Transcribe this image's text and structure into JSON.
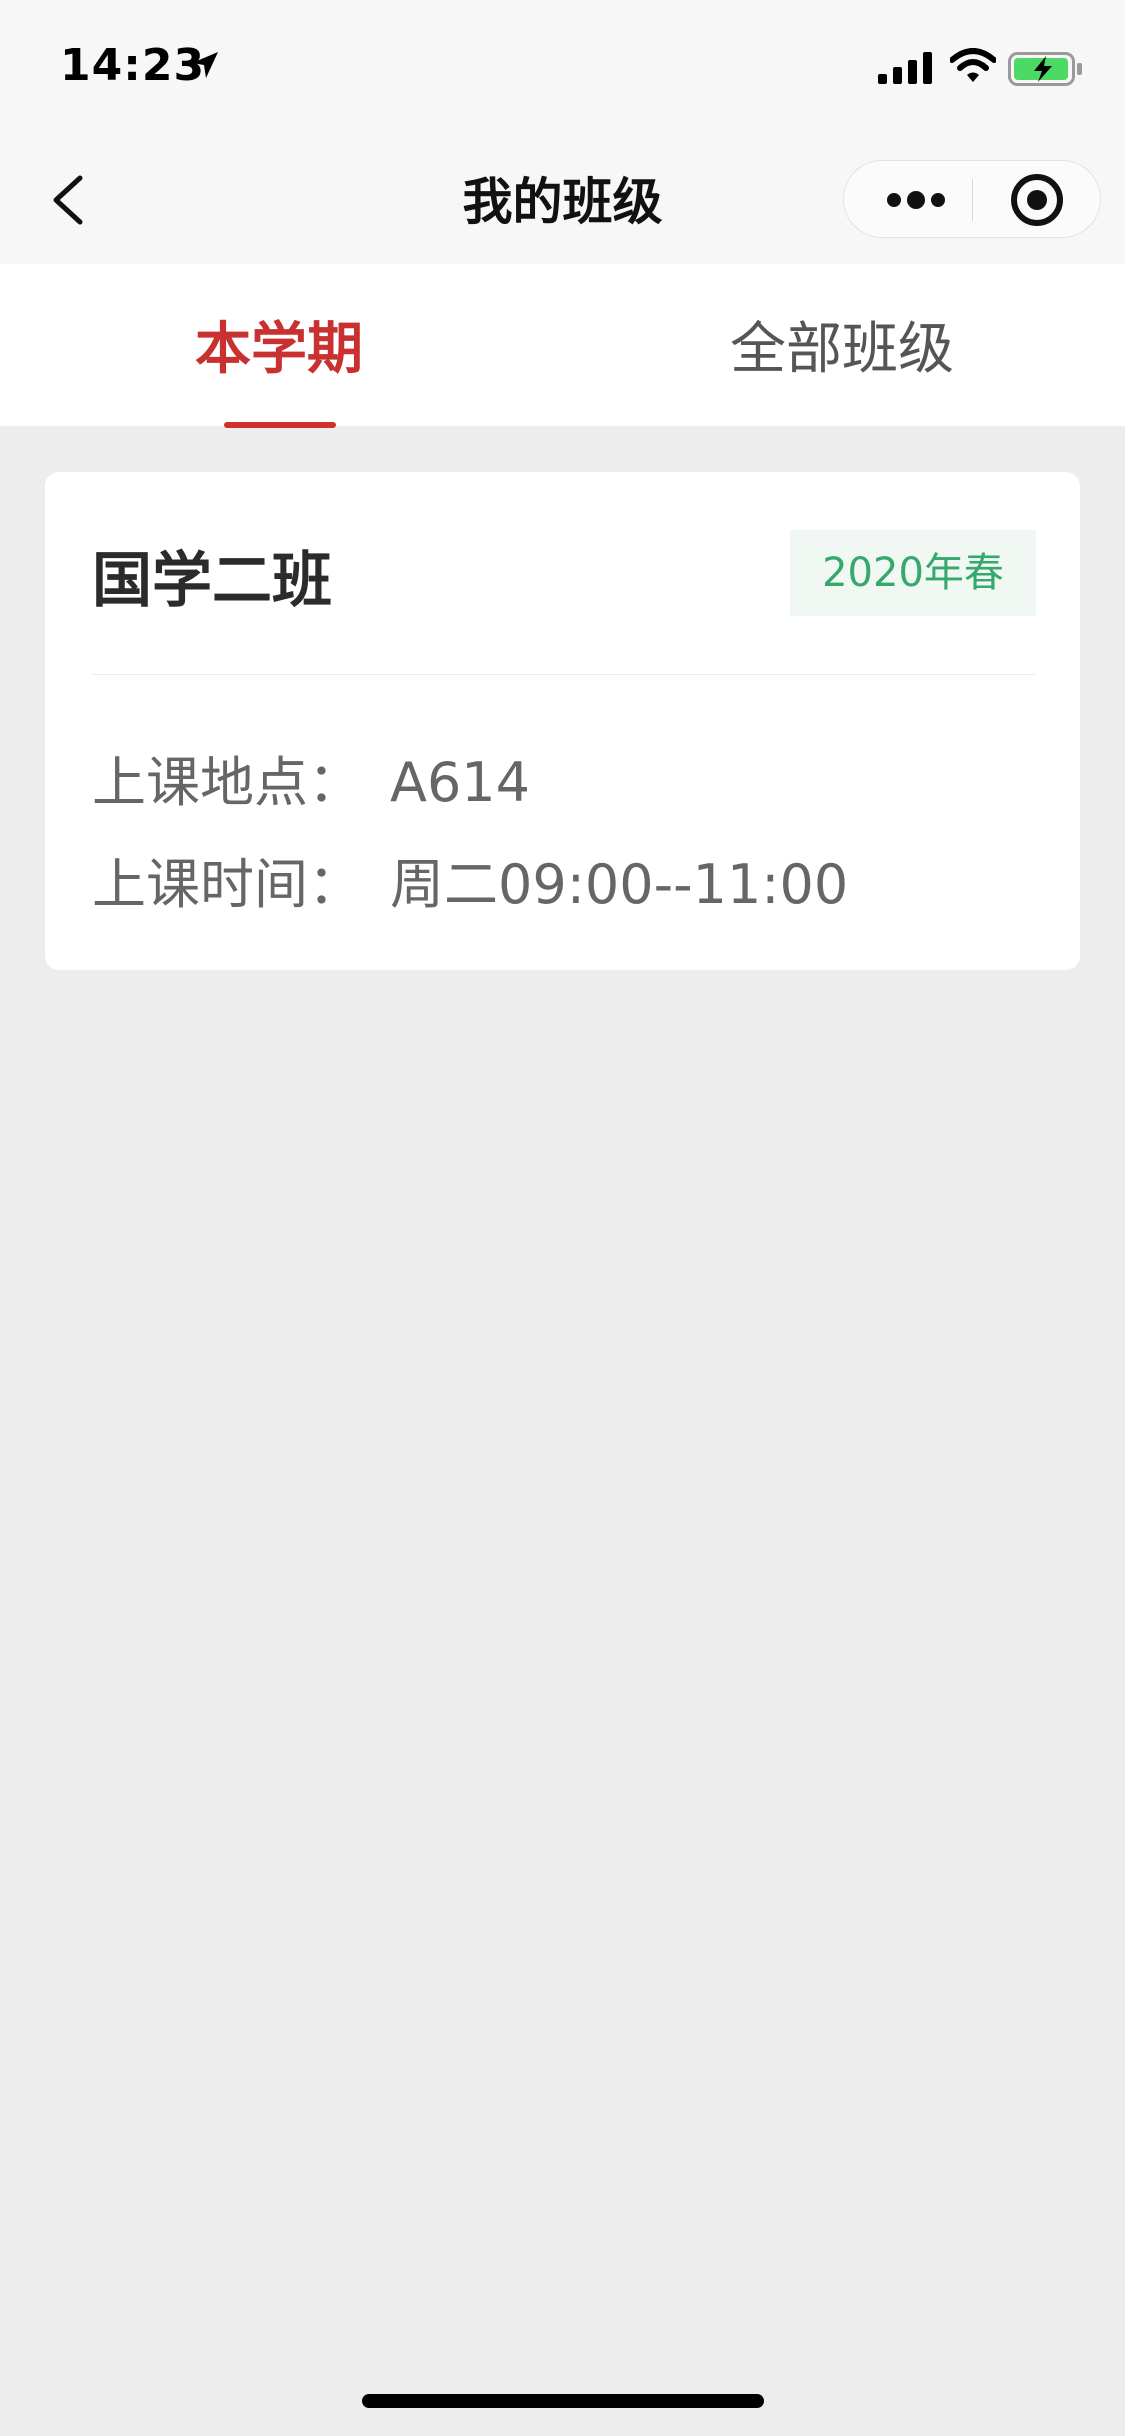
{
  "status_bar": {
    "time": "14:23",
    "icons": [
      "location-arrow-icon",
      "signal-icon",
      "wifi-icon",
      "battery-charging-icon"
    ],
    "battery_color": "#4cd964"
  },
  "nav": {
    "title": "我的班级",
    "back_icon": "chevron-left-icon",
    "more_icon": "more-dots-icon",
    "target_icon": "target-icon"
  },
  "tabs": {
    "items": [
      {
        "label": "本学期",
        "active": true
      },
      {
        "label": "全部班级",
        "active": false
      }
    ],
    "active_color": "#c8312f"
  },
  "classes": [
    {
      "name": "国学二班",
      "term": "2020年春",
      "location_label": "上课地点：",
      "location": "A614",
      "time_label": "上课时间：",
      "time": "周二09:00--11:00"
    }
  ],
  "colors": {
    "accent": "#c8312f",
    "badge_text": "#35a86c",
    "badge_bg": "#f1f8f4",
    "background": "#ededed"
  }
}
